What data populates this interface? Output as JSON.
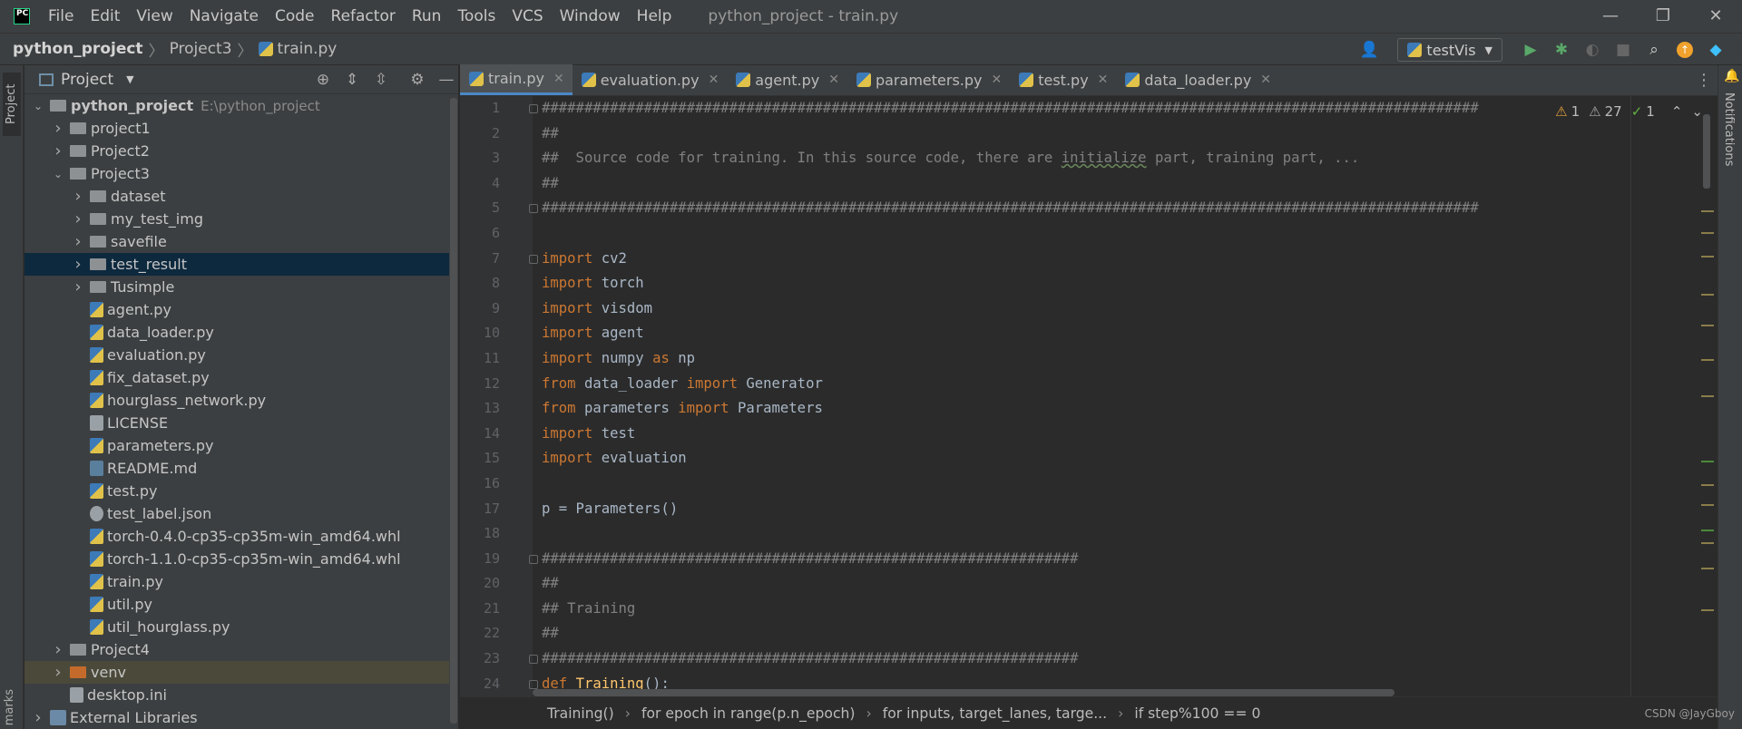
{
  "menubar": {
    "logo": "PC",
    "items": [
      "File",
      "Edit",
      "View",
      "Navigate",
      "Code",
      "Refactor",
      "Run",
      "Tools",
      "VCS",
      "Window",
      "Help"
    ],
    "title": "python_project - train.py",
    "controls": [
      "—",
      "❐",
      "✕"
    ]
  },
  "navbar": {
    "crumbs": [
      "python_project",
      "Project3",
      "train.py"
    ],
    "run_config": "testVis"
  },
  "left_strip": {
    "project_tab": "Project",
    "bookmarks_tab": "marks"
  },
  "project_panel": {
    "title": "Project",
    "tree": [
      {
        "label": "python_project",
        "hint": "E:\\python_project",
        "kind": "folder",
        "depth": 0,
        "expanded": true,
        "bold": true
      },
      {
        "label": "project1",
        "kind": "folder",
        "depth": 1,
        "expanded": false
      },
      {
        "label": "Project2",
        "kind": "folder",
        "depth": 1,
        "expanded": false
      },
      {
        "label": "Project3",
        "kind": "folder",
        "depth": 1,
        "expanded": true
      },
      {
        "label": "dataset",
        "kind": "folder",
        "depth": 2,
        "expanded": false
      },
      {
        "label": "my_test_img",
        "kind": "folder",
        "depth": 2,
        "expanded": false
      },
      {
        "label": "savefile",
        "kind": "folder",
        "depth": 2,
        "expanded": false
      },
      {
        "label": "test_result",
        "kind": "folder",
        "depth": 2,
        "expanded": false,
        "selected": true
      },
      {
        "label": "Tusimple",
        "kind": "folder",
        "depth": 2,
        "expanded": false
      },
      {
        "label": "agent.py",
        "kind": "py",
        "depth": 2
      },
      {
        "label": "data_loader.py",
        "kind": "py",
        "depth": 2
      },
      {
        "label": "evaluation.py",
        "kind": "py",
        "depth": 2
      },
      {
        "label": "fix_dataset.py",
        "kind": "py",
        "depth": 2
      },
      {
        "label": "hourglass_network.py",
        "kind": "py",
        "depth": 2
      },
      {
        "label": "LICENSE",
        "kind": "txt",
        "depth": 2
      },
      {
        "label": "parameters.py",
        "kind": "py",
        "depth": 2
      },
      {
        "label": "README.md",
        "kind": "md",
        "depth": 2
      },
      {
        "label": "test.py",
        "kind": "py",
        "depth": 2
      },
      {
        "label": "test_label.json",
        "kind": "json",
        "depth": 2
      },
      {
        "label": "torch-0.4.0-cp35-cp35m-win_amd64.whl",
        "kind": "py",
        "depth": 2
      },
      {
        "label": "torch-1.1.0-cp35-cp35m-win_amd64.whl",
        "kind": "py",
        "depth": 2
      },
      {
        "label": "train.py",
        "kind": "py",
        "depth": 2
      },
      {
        "label": "util.py",
        "kind": "py",
        "depth": 2
      },
      {
        "label": "util_hourglass.py",
        "kind": "py",
        "depth": 2
      },
      {
        "label": "Project4",
        "kind": "folder",
        "depth": 1,
        "expanded": false
      },
      {
        "label": "venv",
        "kind": "folder-orange",
        "depth": 1,
        "expanded": false,
        "excluded": true
      },
      {
        "label": "desktop.ini",
        "kind": "txt",
        "depth": 1
      },
      {
        "label": "External Libraries",
        "kind": "lib",
        "depth": 0,
        "expanded": false
      }
    ]
  },
  "editor": {
    "tabs": [
      {
        "label": "train.py",
        "active": true
      },
      {
        "label": "evaluation.py"
      },
      {
        "label": "agent.py"
      },
      {
        "label": "parameters.py"
      },
      {
        "label": "test.py"
      },
      {
        "label": "data_loader.py"
      }
    ],
    "inspections": {
      "warn_a": "1",
      "warn_b": "27",
      "ok": "1"
    },
    "code": [
      [
        {
          "t": "##############################################################################################################",
          "c": "cm"
        }
      ],
      [
        {
          "t": "##",
          "c": "cm"
        }
      ],
      [
        {
          "t": "##  Source code for training. In this source code, there are ",
          "c": "cm"
        },
        {
          "t": "initialize",
          "c": "cm squig"
        },
        {
          "t": " part, training part, ...",
          "c": "cm"
        }
      ],
      [
        {
          "t": "##",
          "c": "cm"
        }
      ],
      [
        {
          "t": "##############################################################################################################",
          "c": "cm"
        }
      ],
      [],
      [
        {
          "t": "import",
          "c": "kw"
        },
        {
          "t": " cv2"
        }
      ],
      [
        {
          "t": "import",
          "c": "kw"
        },
        {
          "t": " torch"
        }
      ],
      [
        {
          "t": "import",
          "c": "kw"
        },
        {
          "t": " visdom"
        }
      ],
      [
        {
          "t": "import",
          "c": "kw"
        },
        {
          "t": " agent"
        }
      ],
      [
        {
          "t": "import",
          "c": "kw"
        },
        {
          "t": " numpy "
        },
        {
          "t": "as",
          "c": "kw"
        },
        {
          "t": " np"
        }
      ],
      [
        {
          "t": "from",
          "c": "kw"
        },
        {
          "t": " data_loader "
        },
        {
          "t": "import",
          "c": "kw"
        },
        {
          "t": " Generator"
        }
      ],
      [
        {
          "t": "from",
          "c": "kw"
        },
        {
          "t": " parameters "
        },
        {
          "t": "import",
          "c": "kw"
        },
        {
          "t": " Parameters"
        }
      ],
      [
        {
          "t": "import",
          "c": "kw"
        },
        {
          "t": " test"
        }
      ],
      [
        {
          "t": "import",
          "c": "kw"
        },
        {
          "t": " evaluation"
        }
      ],
      [],
      [
        {
          "t": "p = Parameters()"
        }
      ],
      [],
      [
        {
          "t": "###############################################################",
          "c": "cm"
        }
      ],
      [
        {
          "t": "##",
          "c": "cm"
        }
      ],
      [
        {
          "t": "## Training",
          "c": "cm"
        }
      ],
      [
        {
          "t": "##",
          "c": "cm"
        }
      ],
      [
        {
          "t": "###############################################################",
          "c": "cm"
        }
      ],
      [
        {
          "t": "def",
          "c": "kw"
        },
        {
          "t": " "
        },
        {
          "t": "Training",
          "c": "fn"
        },
        {
          "t": "():"
        }
      ]
    ],
    "breadcrumbs": [
      "Training()",
      "for epoch in range(p.n_epoch)",
      "for inputs, target_lanes, targe...",
      "if step%100 == 0"
    ]
  },
  "right_strip": {
    "notifications": "Notifications"
  },
  "watermark": "CSDN @JayGboy"
}
